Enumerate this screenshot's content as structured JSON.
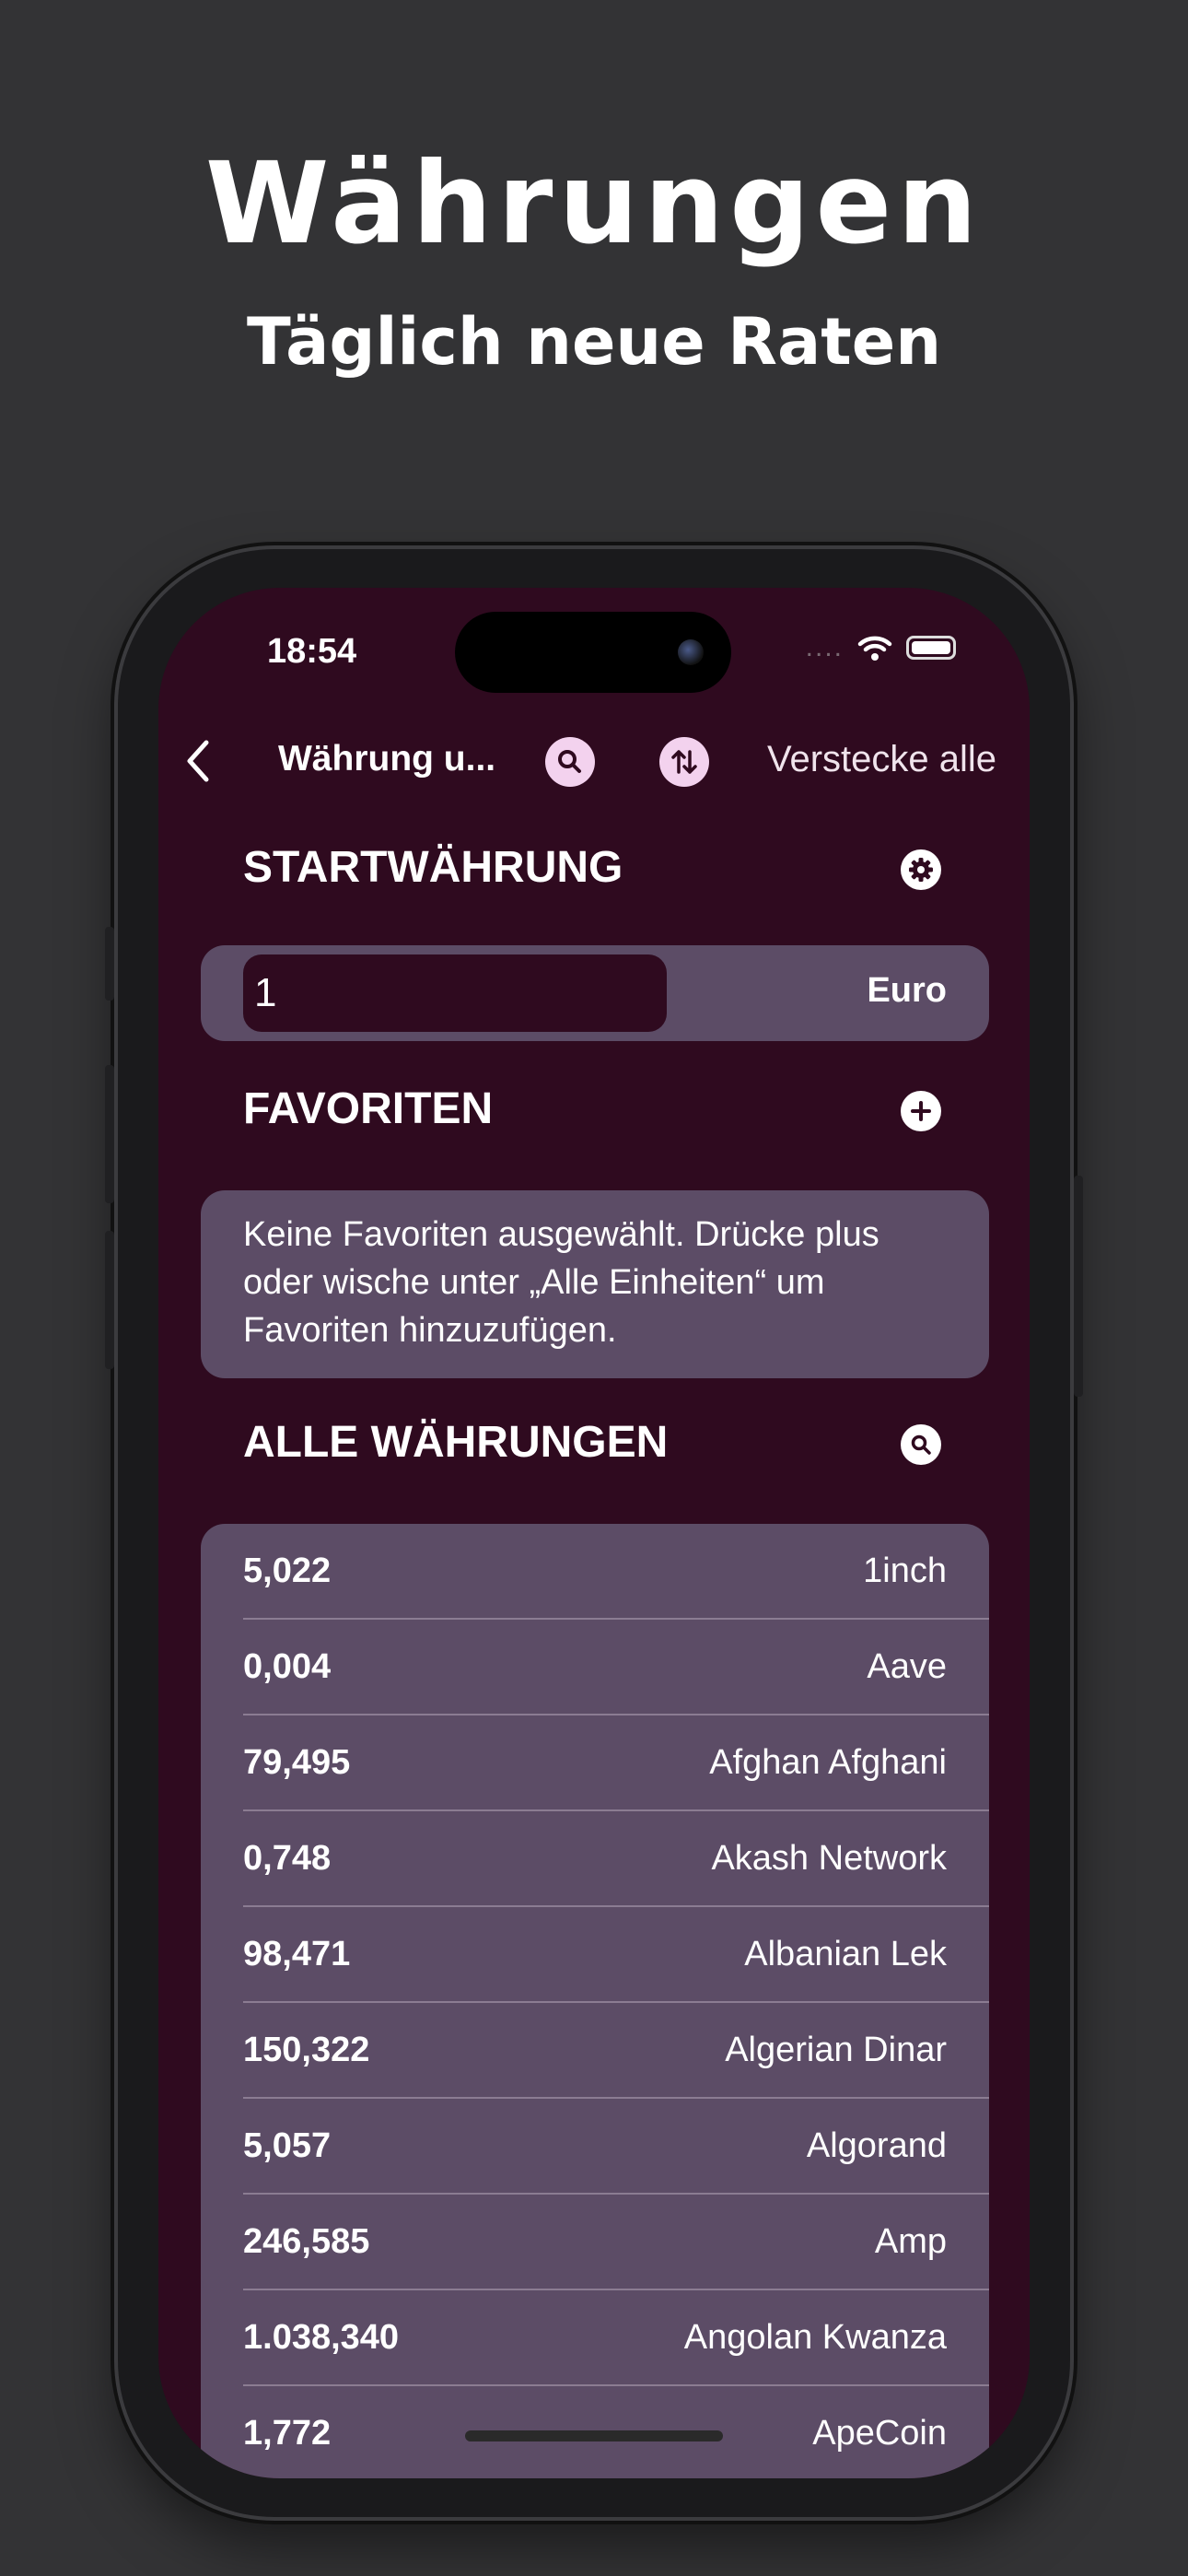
{
  "hero": {
    "title": "Währungen",
    "subtitle": "Täglich neue Raten"
  },
  "status_bar": {
    "time": "18:54",
    "signal": "....",
    "icons": [
      "wifi-icon",
      "battery-icon"
    ]
  },
  "nav": {
    "back_icon": "chevron-left-icon",
    "title": "Währung u...",
    "search_icon": "search-icon",
    "swap_icon": "swap-vertical-icon",
    "action_label": "Verstecke alle"
  },
  "start_currency": {
    "header": "STARTWÄHRUNG",
    "settings_icon": "gear-icon",
    "amount": "1",
    "currency": "Euro"
  },
  "favorites": {
    "header": "FAVORITEN",
    "add_icon": "plus-icon",
    "empty_text": "Keine Favoriten ausgewählt. Drücke plus oder wische unter „Alle Einheiten“ um Favoriten hinzuzufügen."
  },
  "all_currencies": {
    "header": "ALLE WÄHRUNGEN",
    "search_icon": "search-icon",
    "rows": [
      {
        "value": "5,022",
        "name": "1inch"
      },
      {
        "value": "0,004",
        "name": "Aave"
      },
      {
        "value": "79,495",
        "name": "Afghan Afghani"
      },
      {
        "value": "0,748",
        "name": "Akash Network"
      },
      {
        "value": "98,471",
        "name": "Albanian Lek"
      },
      {
        "value": "150,322",
        "name": "Algerian Dinar"
      },
      {
        "value": "5,057",
        "name": "Algorand"
      },
      {
        "value": "246,585",
        "name": "Amp"
      },
      {
        "value": "1.038,340",
        "name": "Angolan Kwanza"
      },
      {
        "value": "1,772",
        "name": "ApeCoin"
      }
    ]
  },
  "colors": {
    "background": "#333335",
    "screen": "#2f0a1f",
    "card": "#5c4c66",
    "icon_accent": "#f3d2ee"
  }
}
